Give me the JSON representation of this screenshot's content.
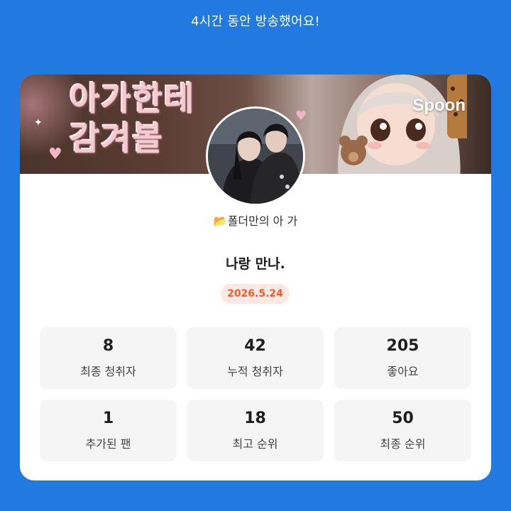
{
  "headline": "4시간 동안 방송했어요!",
  "banner": {
    "text_lines": [
      "아가한테",
      "감겨볼"
    ],
    "brand": "Spoon"
  },
  "profile": {
    "name": "📂폴더만의 아 가"
  },
  "broadcast": {
    "title": "나랑 만나.",
    "date": "2026.5.24"
  },
  "stats": [
    {
      "value": "8",
      "label": "최종 청취자"
    },
    {
      "value": "42",
      "label": "누적 청취자"
    },
    {
      "value": "205",
      "label": "좋아요"
    },
    {
      "value": "1",
      "label": "추가된 팬"
    },
    {
      "value": "18",
      "label": "최고 순위"
    },
    {
      "value": "50",
      "label": "최종 순위"
    }
  ],
  "colors": {
    "background": "#2279E0",
    "card": "#FFFFFF",
    "stat_box": "#F5F5F5",
    "date_badge_bg": "#FDE8E4",
    "date_badge_text": "#F25A2B"
  }
}
